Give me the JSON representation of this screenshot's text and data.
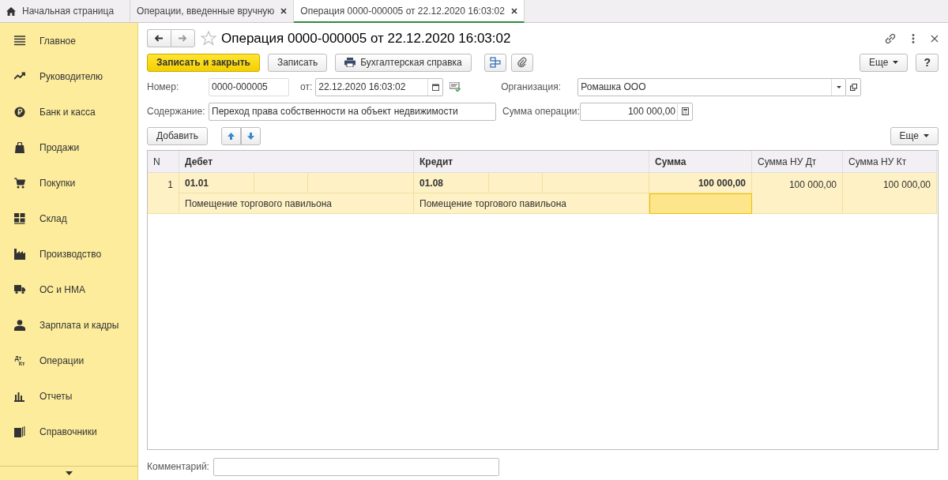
{
  "tabs": [
    {
      "label": "Начальная страница",
      "kind": "home",
      "selected": false
    },
    {
      "label": "Операции, введенные вручную",
      "kind": "closable",
      "selected": false
    },
    {
      "label": "Операция 0000-000005 от 22.12.2020 16:03:02",
      "kind": "closable",
      "selected": true
    }
  ],
  "sidebar": {
    "items": [
      {
        "label": "Главное",
        "kind": "menu"
      },
      {
        "label": "Руководителю",
        "kind": "trend"
      },
      {
        "label": "Банк и касса",
        "kind": "coin"
      },
      {
        "label": "Продажи",
        "kind": "bag"
      },
      {
        "label": "Покупки",
        "kind": "cart"
      },
      {
        "label": "Склад",
        "kind": "grid"
      },
      {
        "label": "Производство",
        "kind": "factory"
      },
      {
        "label": "ОС и НМА",
        "kind": "truck"
      },
      {
        "label": "Зарплата и кадры",
        "kind": "person"
      },
      {
        "label": "Операции",
        "kind": "dtkt",
        "icon_text": [
          "Дт",
          "Кт"
        ]
      },
      {
        "label": "Отчеты",
        "kind": "bars"
      },
      {
        "label": "Справочники",
        "kind": "books"
      }
    ]
  },
  "form": {
    "title": "Операция 0000-000005 от 22.12.2020 16:03:02",
    "buttons": [
      {
        "label": "Записать и закрыть",
        "kind": "primary"
      },
      {
        "label": "Записать",
        "kind": "plain"
      },
      {
        "label": "Бухгалтерская справка",
        "kind": "print"
      }
    ],
    "more_button": "Еще",
    "help_button": "?",
    "number": {
      "label": "Номер:",
      "value": "0000-000005"
    },
    "date": {
      "label": "от:",
      "value": "22.12.2020 16:03:02"
    },
    "organization": {
      "label": "Организация:",
      "value": "Ромашка ООО"
    },
    "content": {
      "label": "Содержание:",
      "value": "Переход права собственности на объект недвижимости"
    },
    "amount": {
      "label": "Сумма операции:",
      "value": "100 000,00"
    },
    "add_button": "Добавить",
    "table_more_button": "Еще",
    "table": {
      "columns": [
        "N",
        "Дебет",
        "Кредит",
        "Сумма",
        "Сумма НУ Дт",
        "Сумма НУ Кт"
      ],
      "rows": [
        {
          "n": "1",
          "debit": "01.01",
          "debit_detail": "Помещение торгового павильона",
          "credit": "01.08",
          "credit_detail": "Помещение торгового павильона",
          "sum": "100 000,00",
          "sum_nu_dt": "100 000,00",
          "sum_nu_kt": "100 000,00",
          "selected": true
        }
      ]
    },
    "comment": {
      "label": "Комментарий:"
    }
  }
}
